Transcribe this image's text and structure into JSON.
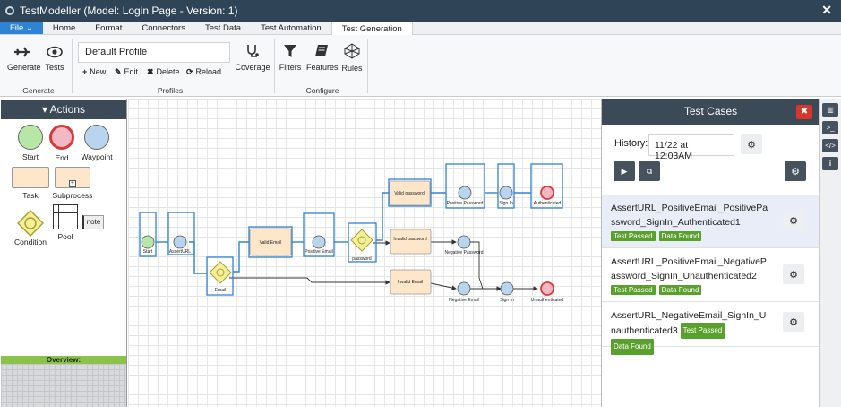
{
  "window": {
    "title": "TestModeller (Model: Login Page - Version: 1)",
    "close": "✕"
  },
  "tabs": [
    "File",
    "Home",
    "Format",
    "Connectors",
    "Test Data",
    "Test Automation",
    "Test Generation"
  ],
  "file_caret": "⌄",
  "ribbon": {
    "generate_group": {
      "label": "Generate",
      "buttons": [
        "Generate",
        "Tests"
      ]
    },
    "profiles_group": {
      "label": "Profiles",
      "current_profile": "Default Profile",
      "actions": [
        "New",
        "Edit",
        "Delete",
        "Reload"
      ],
      "coverage": "Coverage"
    },
    "configure_group": {
      "label": "Configure",
      "buttons": [
        "Filters",
        "Features",
        "Rules"
      ]
    }
  },
  "actions_panel": {
    "title": "Actions",
    "shapes": [
      "Start",
      "End",
      "Waypoint",
      "Task",
      "Subprocess",
      "Condition",
      "Pool",
      "note"
    ],
    "overview_label": "Overview:"
  },
  "diagram": {
    "nodes": [
      "Start",
      "AssertURL",
      "Email",
      "Valid Email",
      "Positive Email",
      "password",
      "Valid password",
      "Positive Password",
      "Sign In",
      "Authenticated",
      "Invalid password",
      "Negative Password",
      "Invalid Email",
      "Negative Email",
      "Sign In",
      "Unauthenticated"
    ]
  },
  "test_cases_panel": {
    "title": "Test Cases",
    "history_label": "History:",
    "history_value": "11/22 at 12:03AM",
    "cases": [
      {
        "name": "AssertURL_PositiveEmail_PositivePassword_SignIn_Authenticated1",
        "badges": [
          "Test Passed",
          "Data Found"
        ],
        "selected": true
      },
      {
        "name": "AssertURL_PositiveEmail_NegativePassword_SignIn_Unauthenticated2",
        "badges": [
          "Test Passed",
          "Data Found"
        ],
        "selected": false
      },
      {
        "name": "AssertURL_NegativeEmail_SignIn_Unauthenticated3",
        "badges": [
          "Test Passed",
          "Data Found"
        ],
        "selected": false
      }
    ]
  },
  "right_sidebar": {
    "icons": [
      "panel-icon",
      "terminal-icon",
      "code-icon",
      "info-icon"
    ],
    "glyphs": [
      "▥",
      ">_",
      "</>",
      "i"
    ]
  },
  "colors": {
    "title_bar": "#2f4557",
    "file_tab": "#2f83d4",
    "panel_header": "#3c4a57",
    "badge_green": "#5aa02c",
    "close_red": "#d9362b",
    "selection_blue": "#2f83d4"
  }
}
